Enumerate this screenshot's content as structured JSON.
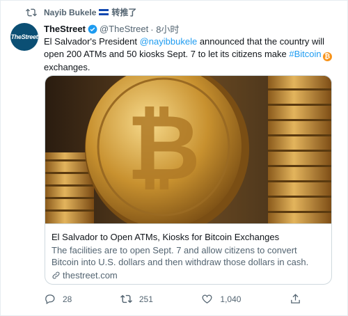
{
  "retweet": {
    "user": "Nayib Bukele",
    "label": "转推了"
  },
  "avatar": {
    "text": "TheStreet"
  },
  "author": {
    "name": "TheStreet",
    "handle": "@TheStreet",
    "time": "· 8小时"
  },
  "tweet": {
    "part1": "El Salvador's President ",
    "mention": "@nayibbukele",
    "part2": " announced that the country will open 200 ATMs and 50 kiosks Sept. 7 to let its citizens make ",
    "hashtag": "#Bitcoin",
    "emoji": "₿",
    "part3": "exchanges."
  },
  "card": {
    "title": "El Salvador to Open ATMs, Kiosks for Bitcoin Exchanges",
    "description": "The facilities are to open Sept. 7 and allow citizens to convert Bitcoin into U.S. dollars and then withdraw those dollars in cash.",
    "domain": "thestreet.com"
  },
  "actions": {
    "replies": "28",
    "retweets": "251",
    "likes": "1,040"
  },
  "colors": {
    "accent": "#1d9bf0",
    "text": "#0f1419",
    "muted": "#536471",
    "bitcoin": "#f7931a"
  }
}
